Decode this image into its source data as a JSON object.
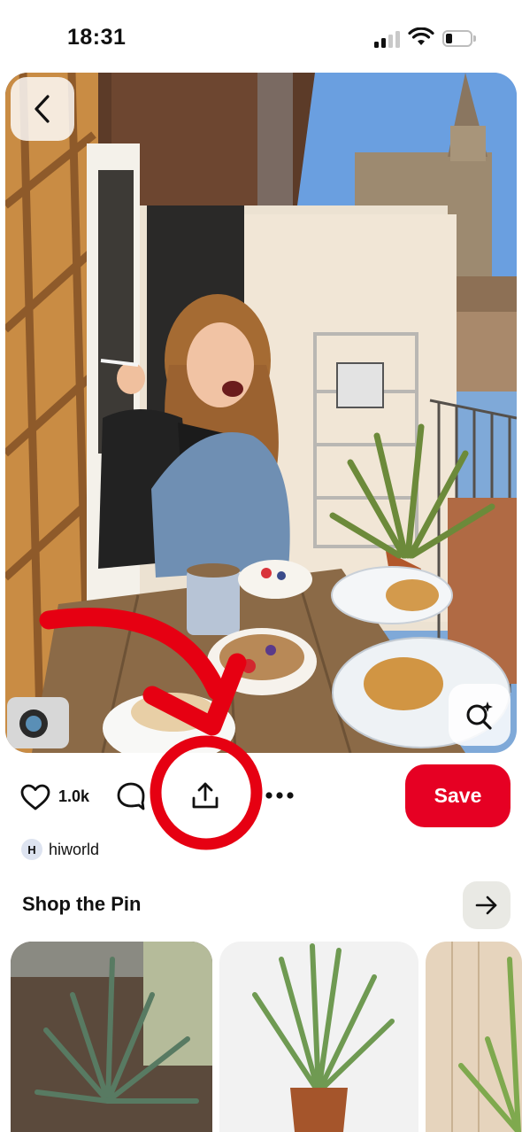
{
  "status_bar": {
    "time": "18:31"
  },
  "pin": {
    "image_icon": "pin-photo"
  },
  "actions": {
    "like_count": "1.0k",
    "save_label": "Save"
  },
  "creator": {
    "avatar_letter": "H",
    "name": "hiworld"
  },
  "shop": {
    "title": "Shop the Pin",
    "products": [
      "product-yucca",
      "product-potted-aloe",
      "product-aloe-wood"
    ]
  },
  "colors": {
    "save": "#e60023",
    "annotation": "#e60012",
    "avatar_bg": "#dde3f0"
  }
}
